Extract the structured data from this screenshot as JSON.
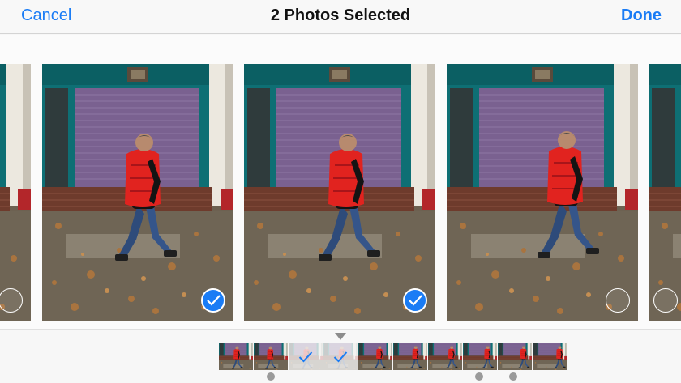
{
  "navbar": {
    "cancel_label": "Cancel",
    "title": "2 Photos Selected",
    "done_label": "Done"
  },
  "colors": {
    "accent": "#1a7cf5",
    "navbar_bg": "#f8f8f8"
  },
  "photos": [
    {
      "selected": false,
      "frame": "edge-left"
    },
    {
      "selected": true,
      "frame": "walking-1"
    },
    {
      "selected": true,
      "frame": "walking-2"
    },
    {
      "selected": false,
      "frame": "walking-3"
    },
    {
      "selected": false,
      "frame": "edge-right"
    }
  ],
  "scrubber": {
    "thumbnail_count": 10,
    "checked_thumbnails": [
      3,
      4
    ],
    "marker_dots": 3
  },
  "icons": {
    "checkmark": "checkmark-icon",
    "pointer": "triangle-down-icon"
  }
}
